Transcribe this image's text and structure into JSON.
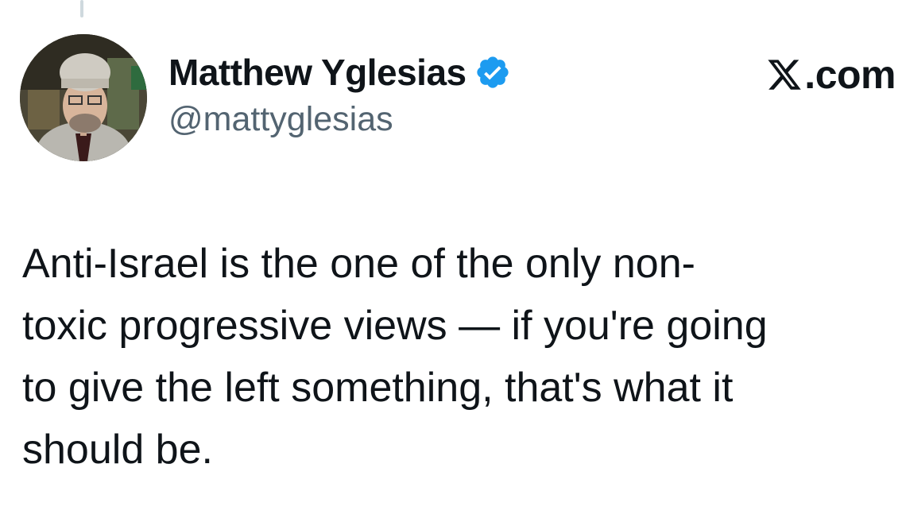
{
  "author": {
    "display_name": "Matthew Yglesias",
    "handle": "@mattyglesias",
    "verified": true,
    "verified_icon": "verified-badge-icon",
    "avatar_icon": "profile-photo"
  },
  "brand": {
    "logo_icon": "x-logo-icon",
    "text": ".com"
  },
  "tweet": {
    "lines": [
      "Anti-Israel is the one of the only non-",
      "toxic progressive views — if you're going",
      "to give the left something, that's what it",
      "should be."
    ]
  },
  "colors": {
    "verified_blue": "#1d9bf0",
    "text_primary": "#0f1419",
    "text_secondary": "#536471"
  }
}
